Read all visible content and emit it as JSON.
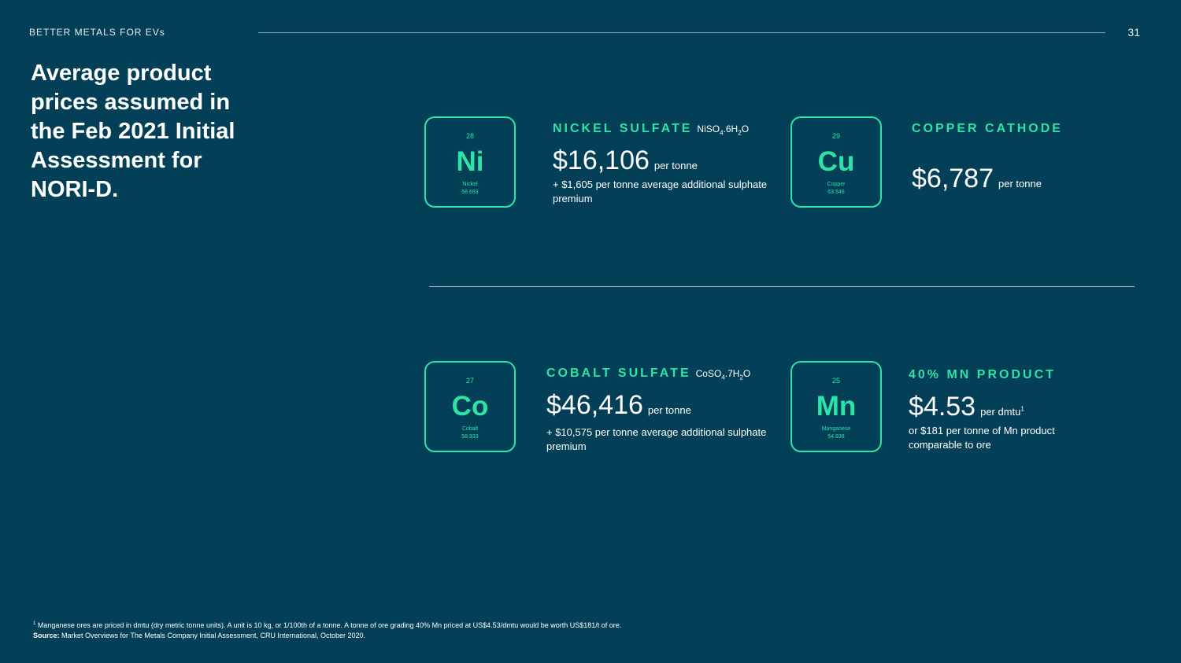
{
  "header": {
    "label": "BETTER METALS FOR EVs",
    "page_number": "31"
  },
  "title": "Average product prices assumed in the Feb 2021 Initial Assessment for NORI-D.",
  "elements": {
    "nickel": {
      "number": "28",
      "symbol": "Ni",
      "name": "Nickel",
      "mass": "58.693"
    },
    "copper": {
      "number": "29",
      "symbol": "Cu",
      "name": "Copper",
      "mass": "63.546"
    },
    "cobalt": {
      "number": "27",
      "symbol": "Co",
      "name": "Cobalt",
      "mass": "58.933"
    },
    "manganese": {
      "number": "25",
      "symbol": "Mn",
      "name": "Manganese",
      "mass": "54.938"
    }
  },
  "products": {
    "nickel": {
      "title": "NICKEL SULFATE",
      "formula": {
        "a": "NiSO",
        "s1": "4",
        "b": ".6H",
        "s2": "2",
        "c": "O"
      },
      "price": "$16,106",
      "unit": "per tonne",
      "note": "+ $1,605 per tonne average additional sulphate premium"
    },
    "copper": {
      "title": "COPPER CATHODE",
      "price": "$6,787",
      "unit": "per tonne"
    },
    "cobalt": {
      "title": "COBALT SULFATE",
      "formula": {
        "a": "CoSO",
        "s1": "4",
        "b": ".7H",
        "s2": "2",
        "c": "O"
      },
      "price": "$46,416",
      "unit": "per tonne",
      "note": "+ $10,575 per tonne average additional sulphate premium"
    },
    "manganese": {
      "title": "40% MN PRODUCT",
      "price": "$4.53",
      "unit": "per dmtu",
      "unit_sup": "1",
      "note": "or $181 per tonne of Mn product comparable to ore"
    }
  },
  "footnote": {
    "marker": "1",
    "text": " Manganese ores are priced in dmtu (dry metric tonne units). A unit is 10 kg, or 1/100th of a tonne. A tonne of ore grading 40% Mn priced at US$4.53/dmtu would be worth US$181/t of ore.",
    "source_label": "Source:",
    "source_text": " Market Overviews for The Metals Company Initial Assessment, CRU International, October 2020."
  },
  "colors": {
    "background": "#033f56",
    "accent": "#2de3a5",
    "text": "#ffffff"
  }
}
